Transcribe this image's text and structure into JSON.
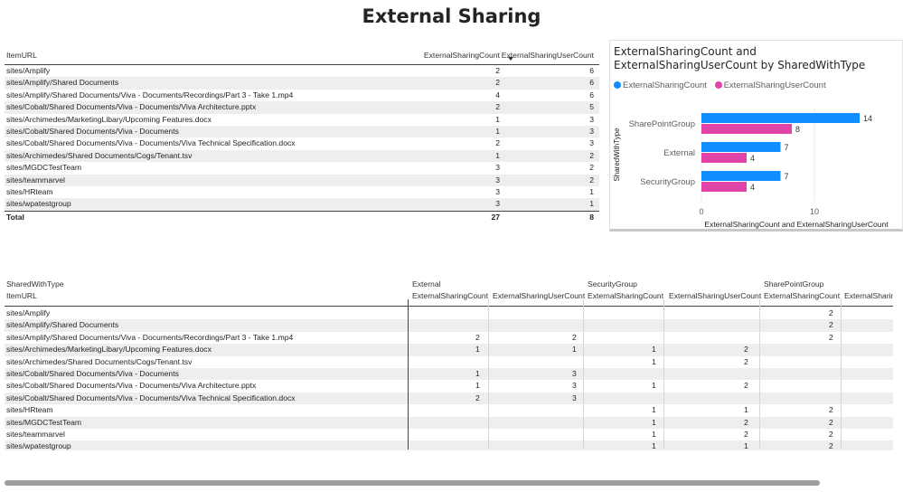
{
  "page": {
    "title": "External Sharing"
  },
  "table1": {
    "headers": [
      "ItemURL",
      "ExternalSharingCount",
      "ExternalSharingUserCount"
    ],
    "rows": [
      [
        "sites/Amplify",
        "2",
        "6"
      ],
      [
        "sites/Amplify/Shared Documents",
        "2",
        "6"
      ],
      [
        "sites/Amplify/Shared Documents/Viva - Documents/Recordings/Part 3 - Take 1.mp4",
        "4",
        "6"
      ],
      [
        "sites/Cobalt/Shared Documents/Viva - Documents/Viva Architecture.pptx",
        "2",
        "5"
      ],
      [
        "sites/Archimedes/MarketingLibary/Upcoming Features.docx",
        "1",
        "3"
      ],
      [
        "sites/Cobalt/Shared Documents/Viva - Documents",
        "1",
        "3"
      ],
      [
        "sites/Cobalt/Shared Documents/Viva - Documents/Viva Technical Specification.docx",
        "2",
        "3"
      ],
      [
        "sites/Archimedes/Shared Documents/Cogs/Tenant.tsv",
        "1",
        "2"
      ],
      [
        "sites/MGDCTestTeam",
        "3",
        "2"
      ],
      [
        "sites/teammarvel",
        "3",
        "2"
      ],
      [
        "sites/HRteam",
        "3",
        "1"
      ],
      [
        "sites/wpatestgroup",
        "3",
        "1"
      ]
    ],
    "total": [
      "Total",
      "27",
      "8"
    ]
  },
  "chart_data": {
    "type": "bar",
    "orientation": "horizontal",
    "title": "ExternalSharingCount and ExternalSharingUserCount by SharedWithType",
    "xlabel": "ExternalSharingCount and ExternalSharingUserCount",
    "ylabel": "SharedWithType",
    "categories": [
      "SharePointGroup",
      "External",
      "SecurityGroup"
    ],
    "series": [
      {
        "name": "ExternalSharingCount",
        "values": [
          14,
          7,
          7
        ],
        "color": "#118DFF"
      },
      {
        "name": "ExternalSharingUserCount",
        "values": [
          8,
          4,
          4
        ],
        "color": "#E044A7"
      }
    ],
    "xticks": [
      "0",
      "10"
    ],
    "xlim": [
      0,
      16
    ],
    "legend": "top-left",
    "grid": true
  },
  "table2": {
    "corner_top": "SharedWithType",
    "corner_bottom": "ItemURL",
    "groups": [
      "External",
      "SecurityGroup",
      "SharePointGroup"
    ],
    "subheaders": [
      "ExternalSharingCount",
      "ExternalSharingUserCount",
      "ExternalSharingCount",
      "ExternalSharingUserCount",
      "ExternalSharingCount",
      "ExternalSharin"
    ],
    "rows": [
      [
        "sites/Amplify",
        "",
        "",
        "",
        "",
        "2",
        ""
      ],
      [
        "sites/Amplify/Shared Documents",
        "",
        "",
        "",
        "",
        "2",
        ""
      ],
      [
        "sites/Amplify/Shared Documents/Viva - Documents/Recordings/Part 3 - Take 1.mp4",
        "2",
        "2",
        "",
        "",
        "2",
        ""
      ],
      [
        "sites/Archimedes/MarketingLibary/Upcoming Features.docx",
        "1",
        "1",
        "1",
        "2",
        "",
        ""
      ],
      [
        "sites/Archimedes/Shared Documents/Cogs/Tenant.tsv",
        "",
        "",
        "1",
        "2",
        "",
        ""
      ],
      [
        "sites/Cobalt/Shared Documents/Viva - Documents",
        "1",
        "3",
        "",
        "",
        "",
        ""
      ],
      [
        "sites/Cobalt/Shared Documents/Viva - Documents/Viva Architecture.pptx",
        "1",
        "3",
        "1",
        "2",
        "",
        ""
      ],
      [
        "sites/Cobalt/Shared Documents/Viva - Documents/Viva Technical Specification.docx",
        "2",
        "3",
        "",
        "",
        "",
        ""
      ],
      [
        "sites/HRteam",
        "",
        "",
        "1",
        "1",
        "2",
        ""
      ],
      [
        "sites/MGDCTestTeam",
        "",
        "",
        "1",
        "2",
        "2",
        ""
      ],
      [
        "sites/teammarvel",
        "",
        "",
        "1",
        "2",
        "2",
        ""
      ],
      [
        "sites/wpatestgroup",
        "",
        "",
        "1",
        "1",
        "2",
        ""
      ]
    ]
  }
}
